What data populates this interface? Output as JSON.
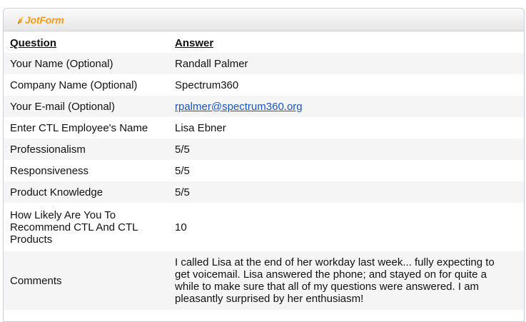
{
  "header": {
    "logo_text": "JotForm",
    "logo_icon": "pencil-icon",
    "brand_color": "#f59a1e"
  },
  "table": {
    "columns": [
      "Question",
      "Answer"
    ],
    "rows": [
      {
        "question": "Your Name (Optional)",
        "answer": "Randall Palmer"
      },
      {
        "question": "Company Name (Optional)",
        "answer": "Spectrum360"
      },
      {
        "question": "Your E-mail (Optional)",
        "answer": "rpalmer@spectrum360.org"
      },
      {
        "question": "Enter CTL Employee's Name",
        "answer": "Lisa Ebner"
      },
      {
        "question": "Professionalism",
        "answer": "5/5"
      },
      {
        "question": "Responsiveness",
        "answer": "5/5"
      },
      {
        "question": "Product Knowledge",
        "answer": "5/5"
      },
      {
        "question": "How Likely Are You To Recommend CTL And CTL Products",
        "answer": "10"
      },
      {
        "question": "Comments",
        "answer": "I called Lisa at the end of her workday last week... fully expecting to get voicemail. Lisa answered the phone; and stayed on for quite a while to make sure that all of my questions were answered. I am pleasantly surprised by her enthusiasm!"
      }
    ]
  },
  "colors": {
    "link": "#1a55c4",
    "alt_row": "#f5f5f5"
  }
}
